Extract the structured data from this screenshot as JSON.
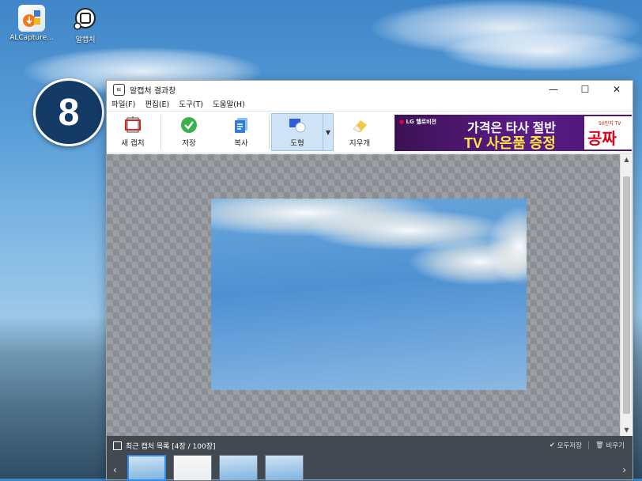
{
  "desktop": {
    "icons": [
      {
        "label": "ALCapture..."
      },
      {
        "label": "알캡처"
      }
    ],
    "step_badge": "8"
  },
  "window": {
    "title": "알캡처 결과창",
    "controls": {
      "minimize": "—",
      "maximize": "☐",
      "close": "✕"
    },
    "menu": [
      "파일(F)",
      "편집(E)",
      "도구(T)",
      "도움말(H)"
    ],
    "toolbar": {
      "new_capture": "새 캡처",
      "save": "저장",
      "copy": "복사",
      "shape": "도형",
      "eraser": "지우개"
    },
    "ad": {
      "brand": "LG 헬로비전",
      "line1": "가격은 타사 절반",
      "line2": "TV 사은품 증정",
      "side_small": "50인치 TV",
      "side_big": "공짜"
    },
    "recent": {
      "title": "최근 캡처 목록 [4장 / 100장]",
      "save_all": "모두저장",
      "clear": "비우기",
      "thumb_count": 4
    }
  },
  "colors": {
    "accent": "#2d8bea",
    "badge_bg": "#143a66",
    "ad_bg": "#4a1470",
    "ad_highlight": "#ffe342",
    "recent_bar": "#434951"
  }
}
